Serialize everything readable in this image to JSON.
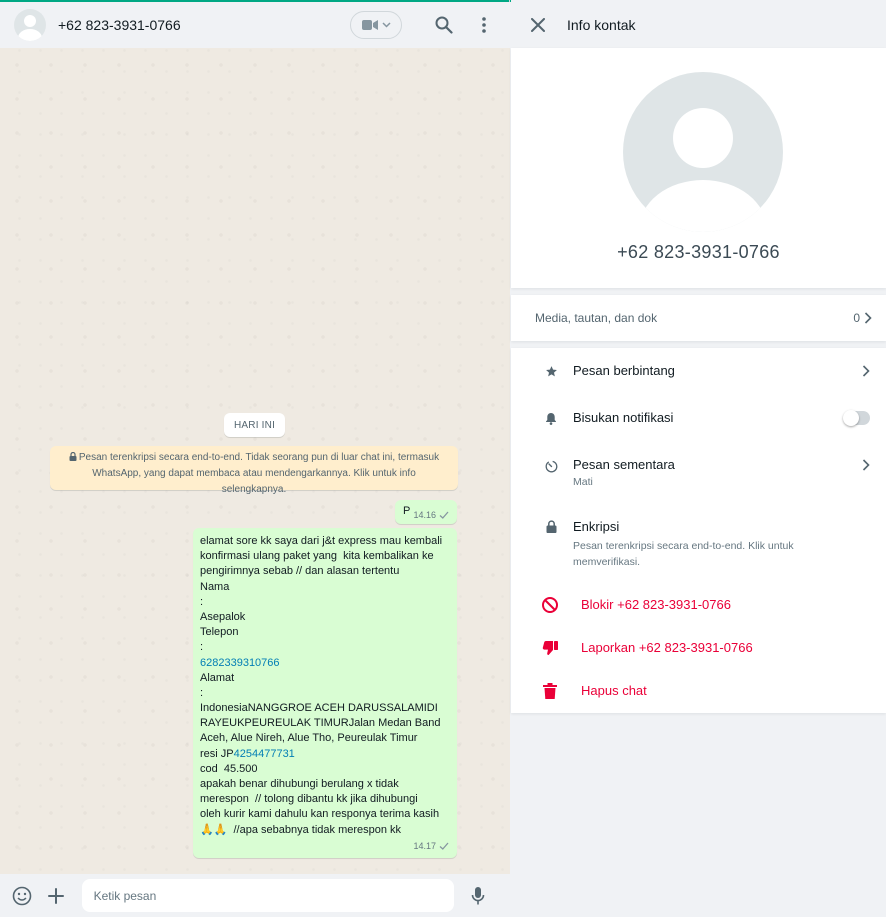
{
  "chat": {
    "contact_name": "+62 823-3931-0766",
    "date_chip": "HARI INI",
    "encryption_notice": {
      "line1": "Pesan terenkripsi secara end-to-end. Tidak seorang pun di luar chat ini, termasuk",
      "line2": "WhatsApp, yang dapat membaca atau mendengarkannya. Klik untuk info selengkapnya."
    },
    "messages": [
      {
        "text": "P",
        "time": "14.16"
      },
      {
        "time": "14.17",
        "lines": [
          "elamat sore kk saya dari j&t express mau kembali",
          "konfirmasi ulang paket yang  kita kembalikan ke",
          "pengirimnya sebab // dan alasan tertentu",
          "Nama",
          ":",
          "Asepalok",
          "Telepon",
          ":",
          "6282339310766",
          "Alamat",
          ":",
          "IndonesiaNANGGROE ACEH DARUSSALAMIDI",
          "RAYEUKPEUREULAK TIMURJalan Medan Band",
          "Aceh, Alue Nireh, Alue Tho, Peureulak Timur",
          "resi JP",
          "4254477731",
          "cod  45.500",
          "apakah benar dihubungi berulang x tidak",
          "merespon  // tolong dibantu kk jika dihubungi",
          "oleh kurir kami dahulu kan responya terima kasih",
          "🙏🙏  //apa sebabnya tidak merespon kk"
        ]
      }
    ],
    "composer_placeholder": "Ketik pesan"
  },
  "info": {
    "title": "Info kontak",
    "name": "+62 823-3931-0766",
    "media": {
      "label": "Media, tautan, dan dok",
      "count": "0"
    },
    "options": {
      "starred": "Pesan berbintang",
      "mute": "Bisukan notifikasi",
      "mute_on": false,
      "disappearing": "Pesan sementara",
      "disappearing_sub": "Mati",
      "encryption": "Enkripsi",
      "encryption_sub1": "Pesan terenkripsi secara end-to-end. Klik untuk",
      "encryption_sub2": "memverifikasi."
    },
    "danger": {
      "block": "Blokir +62 823-3931-0766",
      "report": "Laporkan +62 823-3931-0766",
      "delete": "Hapus chat"
    }
  },
  "colors": {
    "accent": "#00a884",
    "outgoing_bubble": "#d9fdd3",
    "danger": "#ea0038",
    "link": "#027eb5",
    "notice": "#ffeecd"
  },
  "icons": {
    "avatar": "default-avatar-icon",
    "video": "video-camera-icon",
    "search": "search-icon",
    "menu": "more-vertical-icon",
    "close": "close-icon",
    "emoji": "emoji-icon",
    "attach": "plus-icon",
    "mic": "microphone-icon",
    "star": "star-icon",
    "bell": "bell-icon",
    "timer": "timer-icon",
    "lock": "lock-icon",
    "block": "block-icon",
    "report": "thumbs-down-icon",
    "trash": "trash-icon"
  }
}
